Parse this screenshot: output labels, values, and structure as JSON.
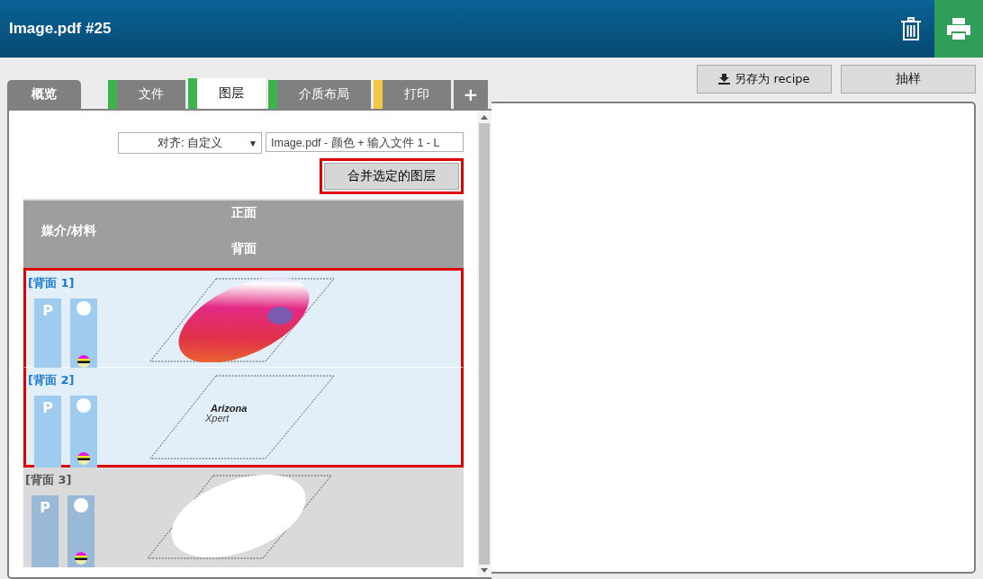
{
  "window": {
    "title": "Image.pdf #25"
  },
  "tabs": [
    {
      "label": "概览",
      "kind": "overview",
      "selected": false
    },
    {
      "label": "文件",
      "kind": "step",
      "color": "#3cb44b",
      "selected": false
    },
    {
      "label": "图层",
      "kind": "step",
      "color": "#3cb44b",
      "selected": true
    },
    {
      "label": "介质布局",
      "kind": "step",
      "color": "#3cb44b",
      "selected": false
    },
    {
      "label": "打印",
      "kind": "step",
      "color": "#f5c842",
      "selected": false
    },
    {
      "label": "+",
      "kind": "add",
      "selected": false
    }
  ],
  "actions": [
    "另存为 recipe",
    "抽样"
  ],
  "align_dropdown": {
    "value": "对齐: 自定义",
    "arrow": "▼"
  },
  "source_field": {
    "value": "Image.pdf - 颜色 + 输入文件 1 - L"
  },
  "merge_button": {
    "label": "合并选定的图层"
  },
  "table_header": {
    "front": "正面",
    "media": "媒介/材料",
    "back": "背面"
  },
  "layers": [
    {
      "label": "[背面 1]",
      "badge": "P",
      "selected": true,
      "kind": "photo"
    },
    {
      "label": "[背面 2]",
      "badge": "P",
      "selected": true,
      "kind": "logo",
      "logo_lines": [
        "Arizona",
        "Xpert"
      ]
    },
    {
      "label": "[背面 3]",
      "badge": "P",
      "selected": false,
      "kind": "shape"
    }
  ]
}
